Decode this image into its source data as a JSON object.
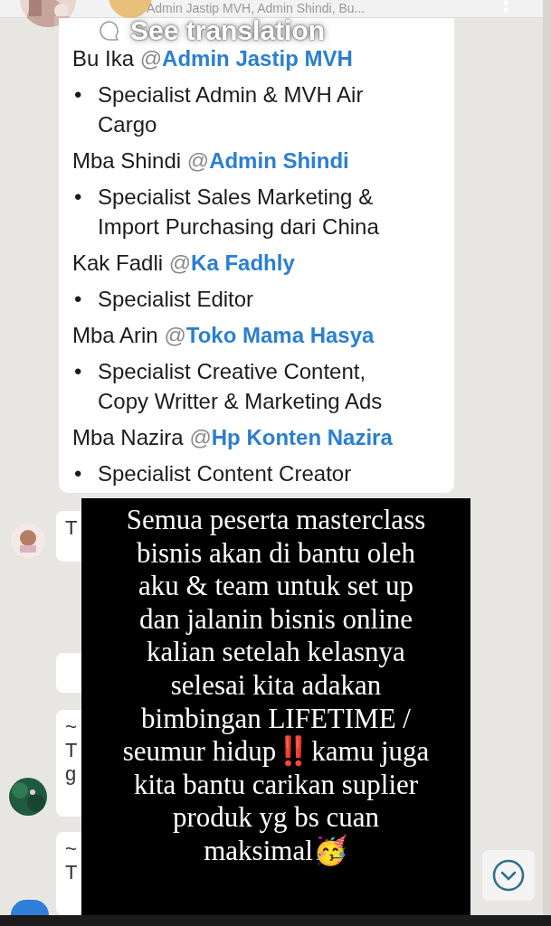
{
  "header": {
    "title": "Admin Jastip MVH, Admin Shindi, Bu..."
  },
  "translation_prompt": "See translation",
  "message": [
    {
      "kind": "mention",
      "name": "Bu Ika",
      "at": "@",
      "handle": "Admin Jastip MVH"
    },
    {
      "kind": "bullet",
      "marker": "•",
      "text": "Specialist Admin & MVH Air Cargo"
    },
    {
      "kind": "mention",
      "name": "Mba Shindi",
      "at": "@",
      "handle": "Admin Shindi"
    },
    {
      "kind": "bullet",
      "marker": "•",
      "text": "Specialist Sales Marketing & Import Purchasing dari China"
    },
    {
      "kind": "mention",
      "name": "Kak Fadli",
      "at": "@",
      "handle": "Ka Fadhly"
    },
    {
      "kind": "bullet",
      "marker": "•",
      "text": "Specialist Editor"
    },
    {
      "kind": "mention",
      "name": "Mba Arin",
      "at": "@",
      "handle": "Toko Mama Hasya"
    },
    {
      "kind": "bullet",
      "marker": "•",
      "text": "Specialist Creative Content, Copy Writter & Marketing Ads"
    },
    {
      "kind": "mention",
      "name": "Mba Nazira",
      "at": "@",
      "handle": "Hp Konten Nazira"
    },
    {
      "kind": "bullet",
      "marker": "•",
      "text": "Specialist Content Creator"
    }
  ],
  "background_bubbles": [
    {
      "kind": "avatar-left",
      "lines": [
        "T"
      ]
    },
    {
      "kind": "plain"
    },
    {
      "kind": "avatar-below",
      "lines": [
        "~",
        "T",
        "g"
      ]
    },
    {
      "kind": "avatar-below-blue",
      "lines": [
        "~",
        "T"
      ]
    }
  ],
  "overlay_caption": [
    "Semua peserta masterclass",
    "bisnis akan di bantu oleh",
    "aku & team untuk set up",
    "dan jalanin bisnis online",
    "kalian setelah kelasnya",
    "selesai kita adakan",
    "bimbingan LIFETIME /",
    "seumur hidup‼️kamu juga",
    "kita bantu carikan suplier",
    "produk yg bs cuan",
    "maksimal🥳"
  ]
}
